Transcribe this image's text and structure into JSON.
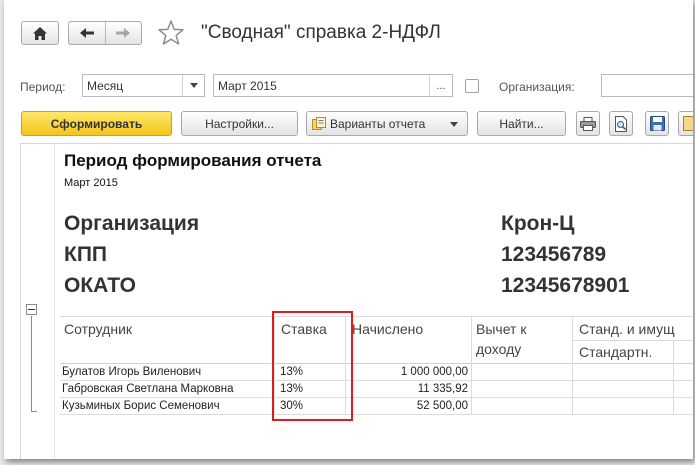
{
  "window": {
    "title": "\"Сводная\" справка 2-НДФЛ"
  },
  "params": {
    "period_label": "Период:",
    "period_type": "Месяц",
    "period_value": "Март 2015",
    "org_label": "Организация:",
    "org_value": ""
  },
  "toolbar": {
    "generate": "Сформировать",
    "settings": "Настройки...",
    "variants": "Варианты отчета",
    "find": "Найти..."
  },
  "report": {
    "period_heading": "Период формирования отчета",
    "period_value": "Март 2015",
    "org_label": "Организация",
    "org_value": "Крон-Ц",
    "kpp_label": "КПП",
    "kpp_value": "123456789",
    "okato_label": "ОКАТО",
    "okato_value": "12345678901",
    "columns": {
      "employee": "Сотрудник",
      "rate": "Ставка",
      "accrued": "Начислено",
      "deduction_line1": "Вычет к",
      "deduction_line2": "доходу",
      "std_group": "Станд. и имущ",
      "std_sub": "Стандартн."
    },
    "rows": [
      {
        "name": "Булатов Игорь Виленович",
        "rate": "13%",
        "accrued": "1 000 000,00"
      },
      {
        "name": "Габровская Светлана Марковна",
        "rate": "13%",
        "accrued": "11 335,92"
      },
      {
        "name": "Кузьминых Борис Семенович",
        "rate": "30%",
        "accrued": "52 500,00"
      }
    ]
  },
  "colors": {
    "primary_button": "#f2c41b",
    "highlight": "#e01b1b"
  }
}
